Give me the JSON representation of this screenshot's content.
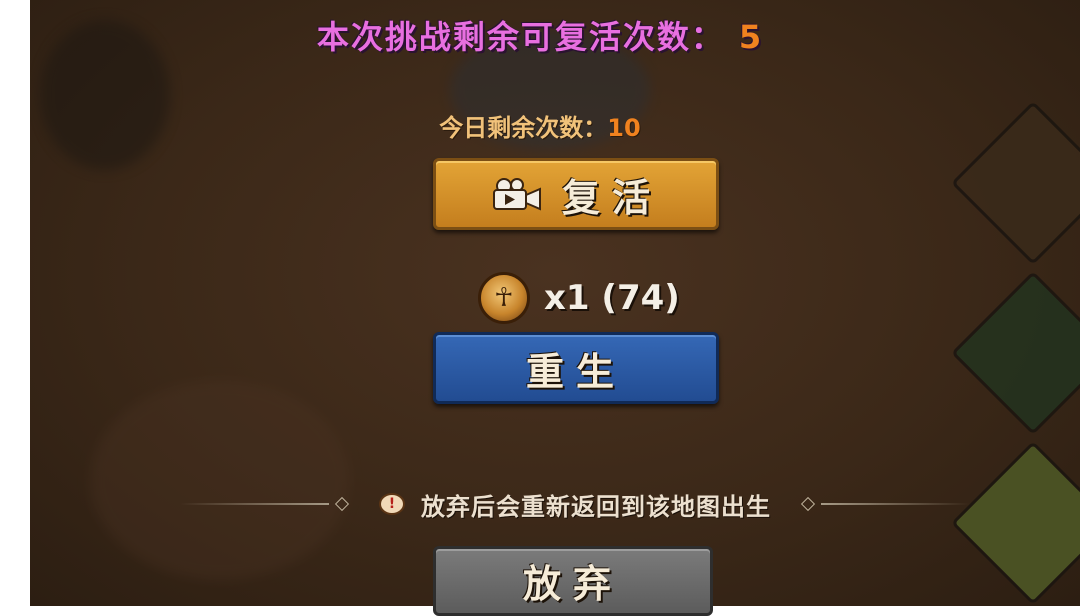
{
  "header": {
    "revive_label": "本次挑战剩余可复活次数：",
    "revive_remaining": "5",
    "daily_label": "今日剩余次数：",
    "daily_remaining": "10"
  },
  "buttons": {
    "revive_label": "复活",
    "reborn_label": "重生",
    "give_up_label": "放弃"
  },
  "cost": {
    "icon": "ankh-coin-icon",
    "text": "x1 (74)"
  },
  "warning": {
    "icon": "exclamation-icon",
    "text": "放弃后会重新返回到该地图出生"
  },
  "colors": {
    "title_pink": "#e86fe0",
    "number_orange": "#f0821f",
    "revive_gold": "#d6952a",
    "reborn_blue": "#2b5aa4",
    "give_up_gray": "#6b6b6b"
  }
}
